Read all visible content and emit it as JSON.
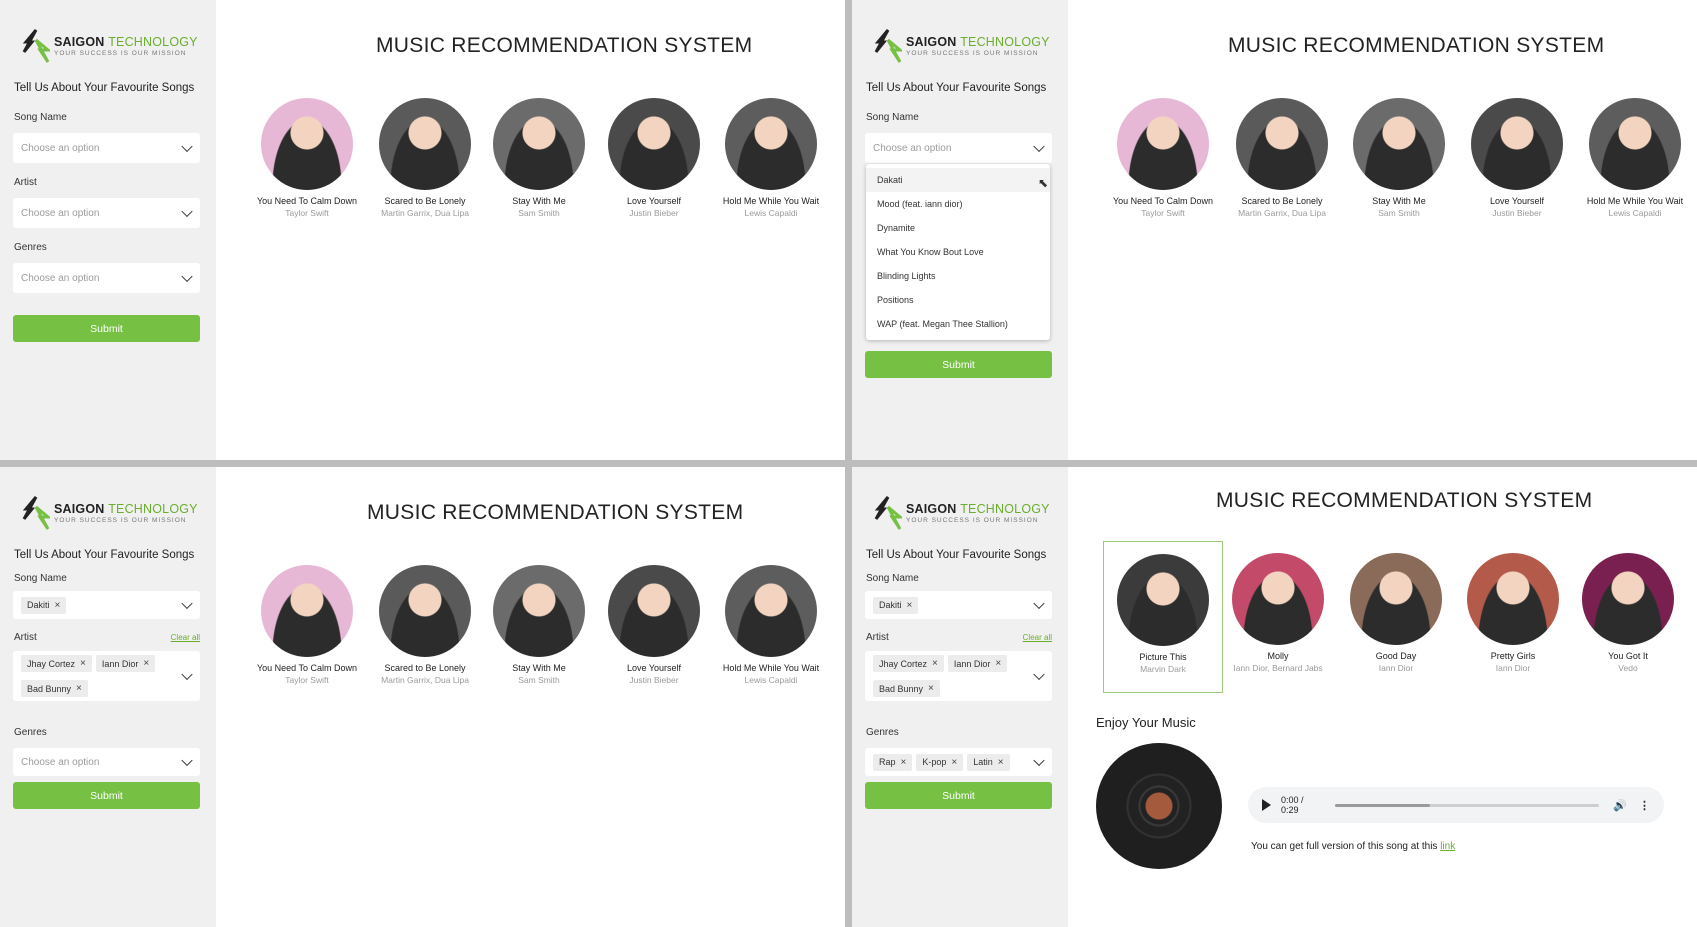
{
  "brand": {
    "name_main": "SAIGON",
    "name_accent": "TECHNOLOGY",
    "tagline": "YOUR SUCCESS IS OUR MISSION",
    "accent_color": "#76c043"
  },
  "sidebar": {
    "heading": "Tell Us About Your Favourite Songs",
    "song_label": "Song Name",
    "artist_label": "Artist",
    "genres_label": "Genres",
    "placeholder": "Choose an option",
    "clear_all": "Clear all",
    "submit_label": "Submit"
  },
  "title": "MUSIC RECOMMENDATION SYSTEM",
  "default_songs": [
    {
      "title": "You Need To Calm Down",
      "artist": "Taylor Swift",
      "color": "#e7b8d6",
      "icon": "portrait"
    },
    {
      "title": "Scared to Be Lonely",
      "artist": "Martin Garrix, Dua Lipa",
      "color": "#5a5a5a",
      "icon": "portrait"
    },
    {
      "title": "Stay With Me",
      "artist": "Sam Smith",
      "color": "#6b6b6b",
      "icon": "portrait"
    },
    {
      "title": "Love Yourself",
      "artist": "Justin Bieber",
      "color": "#4a4a4a",
      "icon": "portrait"
    },
    {
      "title": "Hold Me While You Wait",
      "artist": "Lewis Capaldi",
      "color": "#5d5d5d",
      "icon": "portrait"
    }
  ],
  "dropdown_options": [
    "Dakati",
    "Mood (feat. iann dior)",
    "Dynamite",
    "What You Know Bout Love",
    "Blinding Lights",
    "Positions",
    "WAP (feat. Megan Thee Stallion)"
  ],
  "selection": {
    "song_tags": [
      "Dakiti"
    ],
    "artist_tags": [
      "Jhay Cortez",
      "Iann Dior",
      "Bad Bunny"
    ],
    "genre_tags": [
      "Rap",
      "K-pop",
      "Latin"
    ]
  },
  "recommended_songs": [
    {
      "title": "Picture This",
      "artist": "Marvin Dark",
      "color": "#3b3b3b",
      "icon": "portrait"
    },
    {
      "title": "Molly",
      "artist": "Iann Dior, Bernard Jabs",
      "color": "#c44a6a",
      "icon": "portrait"
    },
    {
      "title": "Good Day",
      "artist": "Iann Dior",
      "color": "#8a6a58",
      "icon": "portrait"
    },
    {
      "title": "Pretty Girls",
      "artist": "Iann Dior",
      "color": "#b45a4a",
      "icon": "portrait"
    },
    {
      "title": "You Got It",
      "artist": "Vedo",
      "color": "#7a2050",
      "icon": "portrait"
    }
  ],
  "player": {
    "enjoy_heading": "Enjoy Your Music",
    "time": "0:00 / 0:29",
    "progress": 0.36,
    "note": "You can get full version of this song at this",
    "link_text": "link"
  }
}
